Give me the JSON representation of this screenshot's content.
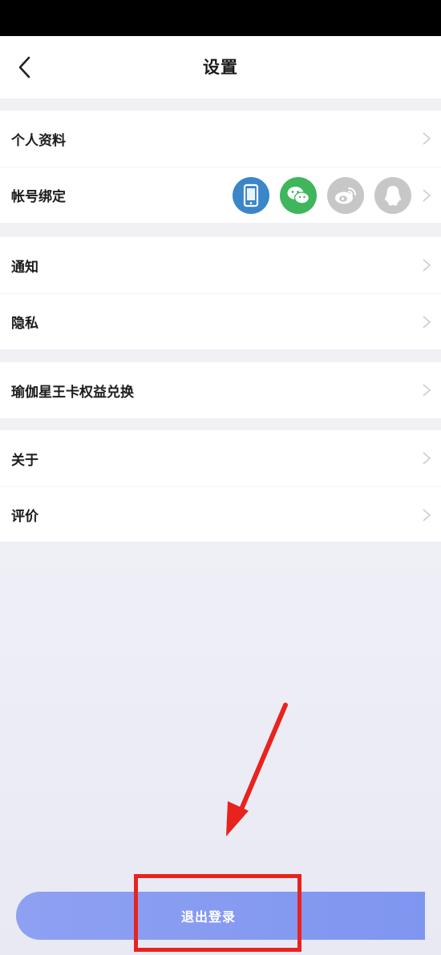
{
  "header": {
    "title": "设置",
    "back_icon": "chevron-left-icon"
  },
  "settings_groups": [
    {
      "items": [
        {
          "label": "个人资料"
        },
        {
          "label": "帐号绑定",
          "bindings": [
            "phone-icon",
            "wechat-icon",
            "weibo-icon",
            "qq-icon"
          ]
        }
      ]
    },
    {
      "items": [
        {
          "label": "通知"
        },
        {
          "label": "隐私"
        }
      ]
    },
    {
      "items": [
        {
          "label": "瑜伽星王卡权益兑换"
        }
      ]
    },
    {
      "items": [
        {
          "label": "关于"
        },
        {
          "label": "评价"
        }
      ]
    }
  ],
  "logout": {
    "label": "退出登录"
  },
  "colors": {
    "accent": "#7f96f0",
    "phone_bind": "#3a86c8",
    "wechat_bind": "#3fb55c",
    "unbound": "#c7c7c7",
    "annotation": "#e8231e"
  }
}
